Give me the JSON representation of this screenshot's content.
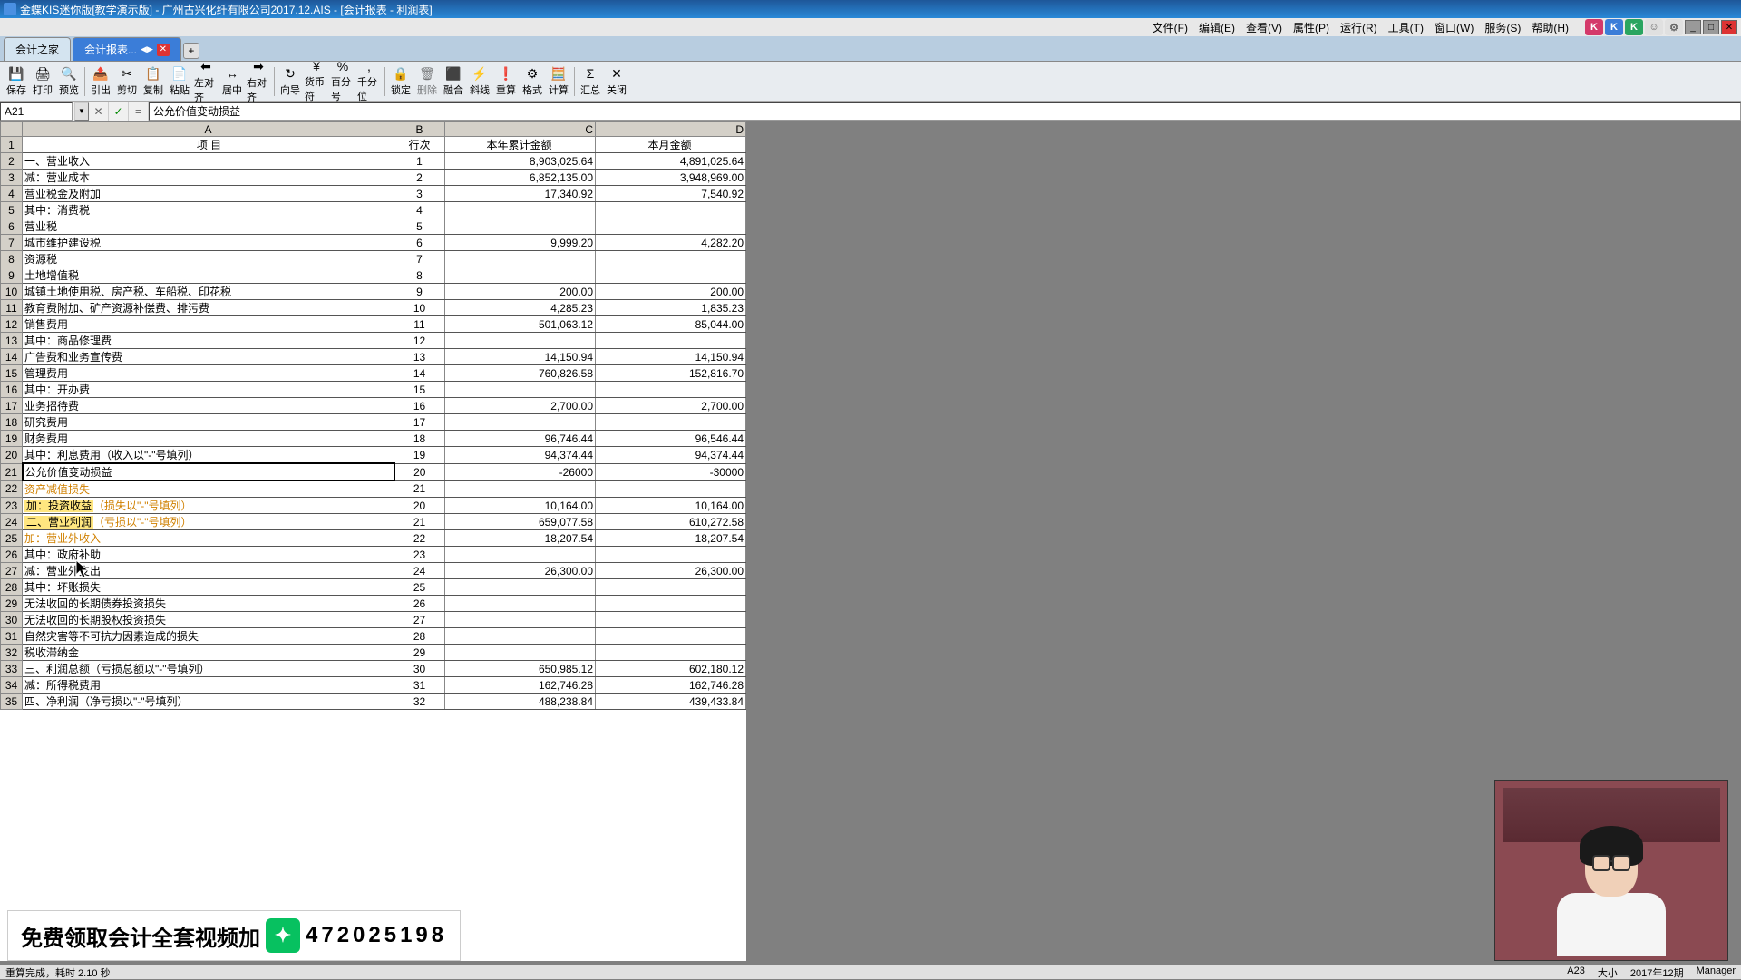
{
  "window": {
    "title": "金蝶KIS迷你版[教学演示版] - 广州古兴化纤有限公司2017.12.AIS - [会计报表 - 利润表]"
  },
  "menus": [
    "文件(F)",
    "编辑(E)",
    "查看(V)",
    "属性(P)",
    "运行(R)",
    "工具(T)",
    "窗口(W)",
    "服务(S)",
    "帮助(H)"
  ],
  "tabs": {
    "home": "会计之家",
    "active": "会计报表..."
  },
  "toolbar": [
    {
      "icon": "💾",
      "label": "保存",
      "name": "save"
    },
    {
      "icon": "🖨",
      "label": "打印",
      "name": "print"
    },
    {
      "icon": "🔍",
      "label": "预览",
      "name": "preview"
    },
    {
      "sep": true
    },
    {
      "icon": "📤",
      "label": "引出",
      "name": "export"
    },
    {
      "icon": "✂",
      "label": "剪切",
      "name": "cut"
    },
    {
      "icon": "📋",
      "label": "复制",
      "name": "copy"
    },
    {
      "icon": "📄",
      "label": "粘贴",
      "name": "paste"
    },
    {
      "icon": "⬅",
      "label": "左对齐",
      "name": "align-left"
    },
    {
      "icon": "↔",
      "label": "居中",
      "name": "align-center"
    },
    {
      "icon": "➡",
      "label": "右对齐",
      "name": "align-right"
    },
    {
      "sep": true
    },
    {
      "icon": "↻",
      "label": "向导",
      "name": "wizard"
    },
    {
      "icon": "¥",
      "label": "货币符",
      "name": "currency"
    },
    {
      "icon": "%",
      "label": "百分号",
      "name": "percent"
    },
    {
      "icon": ",",
      "label": "千分位",
      "name": "thousands"
    },
    {
      "sep": true
    },
    {
      "icon": "🔒",
      "label": "锁定",
      "name": "lock"
    },
    {
      "icon": "🗑",
      "label": "删除",
      "name": "delete",
      "disabled": true
    },
    {
      "icon": "⬛",
      "label": "融合",
      "name": "merge"
    },
    {
      "icon": "⚡",
      "label": "斜线",
      "name": "slash"
    },
    {
      "icon": "❗",
      "label": "重算",
      "name": "recalc"
    },
    {
      "icon": "⚙",
      "label": "格式",
      "name": "format"
    },
    {
      "icon": "🧮",
      "label": "计算",
      "name": "compute"
    },
    {
      "sep": true
    },
    {
      "icon": "Σ",
      "label": "汇总",
      "name": "sum"
    },
    {
      "icon": "✕",
      "label": "关闭",
      "name": "close"
    }
  ],
  "cell_ref": "A21",
  "formula_value": "公允价值变动损益",
  "columns": {
    "A": "A",
    "B": "B",
    "C": "C",
    "D": "D"
  },
  "header_row": {
    "A": "项    目",
    "B": "行次",
    "C": "本年累计金额",
    "D": "本月金额"
  },
  "rows": [
    {
      "n": 2,
      "a": "一、营业收入",
      "b": "1",
      "c": "8,903,025.64",
      "d": "4,891,025.64"
    },
    {
      "n": 3,
      "a": "减：营业成本",
      "b": "2",
      "c": "6,852,135.00",
      "d": "3,948,969.00"
    },
    {
      "n": 4,
      "a": "    营业税金及附加",
      "b": "3",
      "c": "17,340.92",
      "d": "7,540.92"
    },
    {
      "n": 5,
      "a": "      其中：消费税",
      "b": "4",
      "c": "",
      "d": ""
    },
    {
      "n": 6,
      "a": "            营业税",
      "b": "5",
      "c": "",
      "d": ""
    },
    {
      "n": 7,
      "a": "            城市维护建设税",
      "b": "6",
      "c": "9,999.20",
      "d": "4,282.20"
    },
    {
      "n": 8,
      "a": "            资源税",
      "b": "7",
      "c": "",
      "d": ""
    },
    {
      "n": 9,
      "a": "            土地增值税",
      "b": "8",
      "c": "",
      "d": ""
    },
    {
      "n": 10,
      "a": "            城镇土地使用税、房产税、车船税、印花税",
      "b": "9",
      "c": "200.00",
      "d": "200.00"
    },
    {
      "n": 11,
      "a": "            教育费附加、矿产资源补偿费、排污费",
      "b": "10",
      "c": "4,285.23",
      "d": "1,835.23"
    },
    {
      "n": 12,
      "a": "    销售费用",
      "b": "11",
      "c": "501,063.12",
      "d": "85,044.00"
    },
    {
      "n": 13,
      "a": "      其中：商品修理费",
      "b": "12",
      "c": "",
      "d": ""
    },
    {
      "n": 14,
      "a": "            广告费和业务宣传费",
      "b": "13",
      "c": "14,150.94",
      "d": "14,150.94"
    },
    {
      "n": 15,
      "a": "    管理费用",
      "b": "14",
      "c": "760,826.58",
      "d": "152,816.70"
    },
    {
      "n": 16,
      "a": "      其中：开办费",
      "b": "15",
      "c": "",
      "d": ""
    },
    {
      "n": 17,
      "a": "            业务招待费",
      "b": "16",
      "c": "2,700.00",
      "d": "2,700.00"
    },
    {
      "n": 18,
      "a": "            研究费用",
      "b": "17",
      "c": "",
      "d": ""
    },
    {
      "n": 19,
      "a": "    财务费用",
      "b": "18",
      "c": "96,746.44",
      "d": "96,546.44"
    },
    {
      "n": 20,
      "a": "      其中：利息费用（收入以\"-\"号填列）",
      "b": "19",
      "c": "94,374.44",
      "d": "94,374.44"
    },
    {
      "n": 21,
      "a": "公允价值变动损益",
      "b": "20",
      "c": "-26000",
      "d": "-30000",
      "selected": true
    },
    {
      "n": 22,
      "a": "资产减值损失",
      "b": "21",
      "c": "",
      "d": "",
      "hl": 2
    },
    {
      "n": 23,
      "a": "加：投资收益（损失以\"-\"号填列）",
      "b": "20",
      "c": "10,164.00",
      "d": "10,164.00",
      "hl": 1
    },
    {
      "n": 24,
      "a": "二、营业利润（亏损以\"-\"号填列）",
      "b": "21",
      "c": "659,077.58",
      "d": "610,272.58",
      "hl": 1
    },
    {
      "n": 25,
      "a": "加：营业外收入",
      "b": "22",
      "c": "18,207.54",
      "d": "18,207.54",
      "hl": 2
    },
    {
      "n": 26,
      "a": "    其中：政府补助",
      "b": "23",
      "c": "",
      "d": ""
    },
    {
      "n": 27,
      "a": "减：营业外支出",
      "b": "24",
      "c": "26,300.00",
      "d": "26,300.00"
    },
    {
      "n": 28,
      "a": "    其中：坏账损失",
      "b": "25",
      "c": "",
      "d": ""
    },
    {
      "n": 29,
      "a": "          无法收回的长期债券投资损失",
      "b": "26",
      "c": "",
      "d": ""
    },
    {
      "n": 30,
      "a": "          无法收回的长期股权投资损失",
      "b": "27",
      "c": "",
      "d": ""
    },
    {
      "n": 31,
      "a": "          自然灾害等不可抗力因素造成的损失",
      "b": "28",
      "c": "",
      "d": ""
    },
    {
      "n": 32,
      "a": "          税收滞纳金",
      "b": "29",
      "c": "",
      "d": ""
    },
    {
      "n": 33,
      "a": "三、利润总额（亏损总额以\"-\"号填列）",
      "b": "30",
      "c": "650,985.12",
      "d": "602,180.12"
    },
    {
      "n": 34,
      "a": "减：所得税费用",
      "b": "31",
      "c": "162,746.28",
      "d": "162,746.28"
    },
    {
      "n": 35,
      "a": "四、净利润（净亏损以\"-\"号填列）",
      "b": "32",
      "c": "488,238.84",
      "d": "439,433.84"
    }
  ],
  "watermark": {
    "text1": "免费领取会计全套视频加",
    "text2": "472025198"
  },
  "status": {
    "left": "重算完成，耗时 2.10 秒",
    "cell": "A23",
    "zoom": "大小",
    "period": "2017年12期",
    "user": "Manager"
  }
}
